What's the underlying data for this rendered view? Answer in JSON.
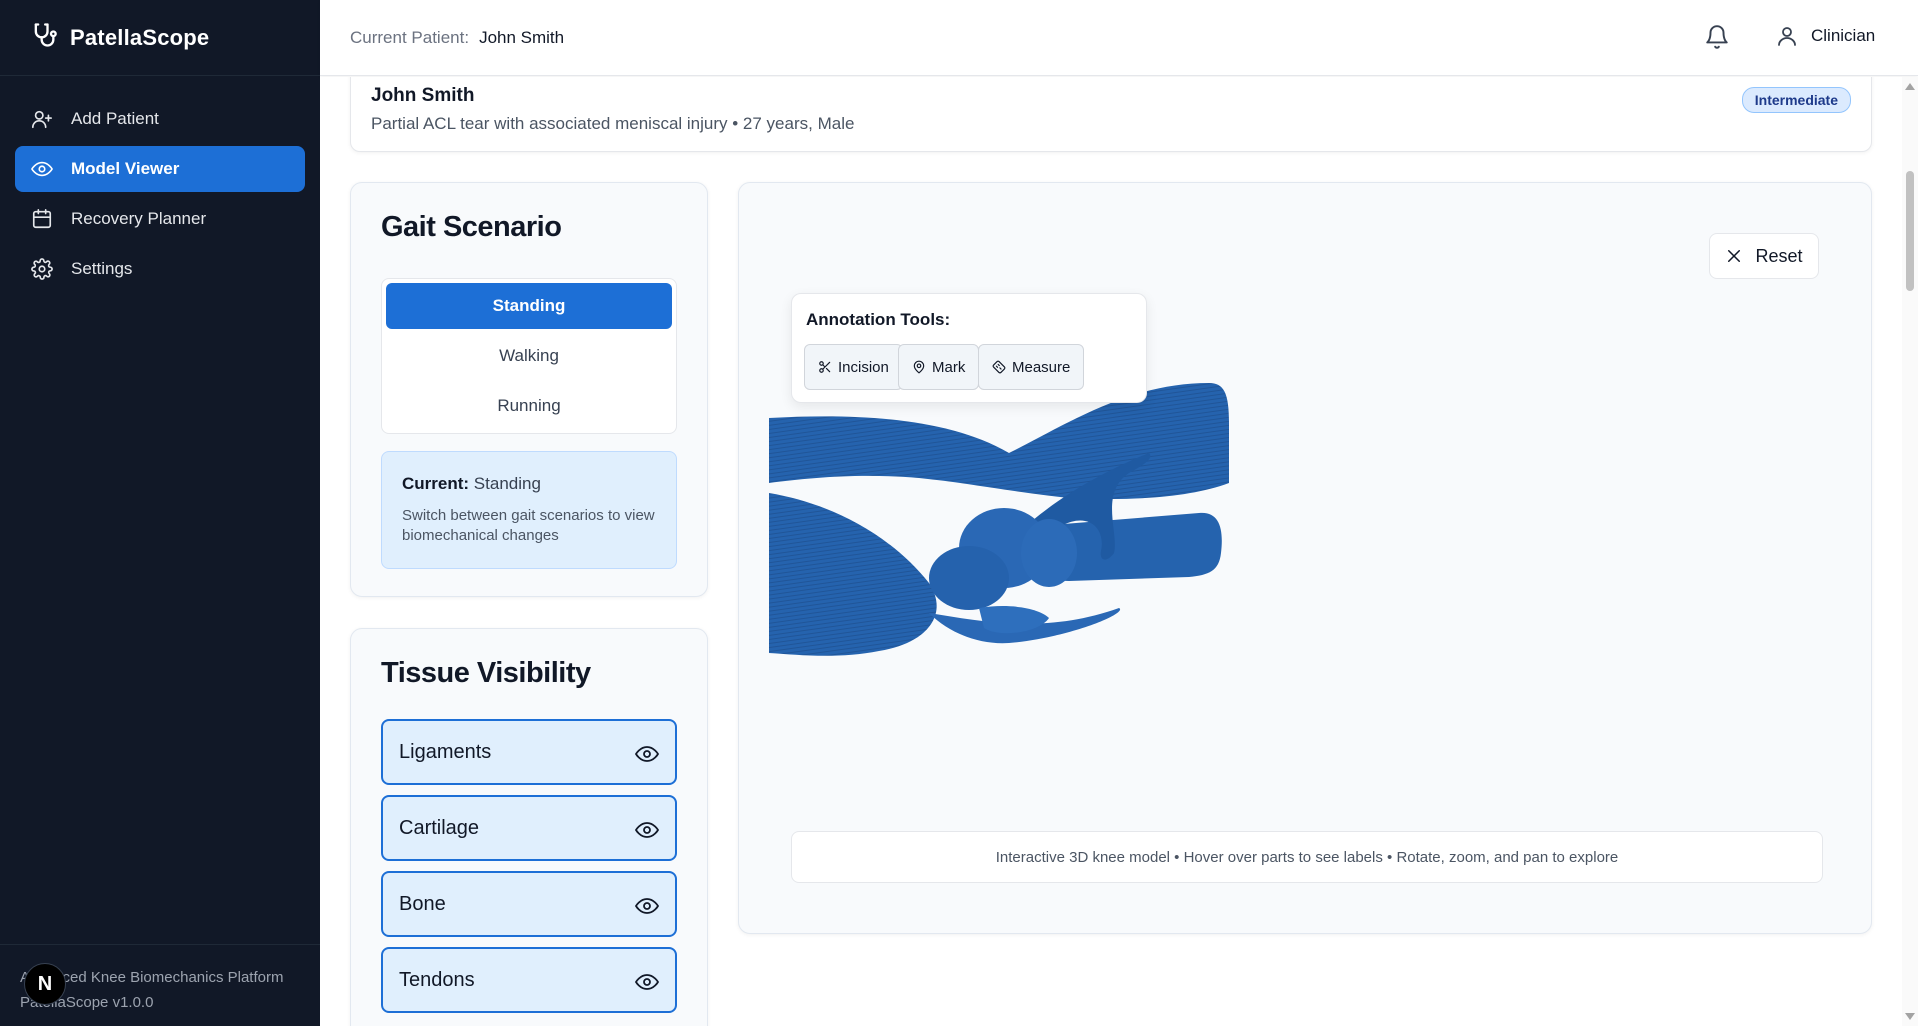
{
  "app": {
    "name": "PatellaScope",
    "logo_icon": "stethoscope-icon"
  },
  "sidebar": {
    "items": [
      {
        "label": "Add Patient",
        "icon": "user-plus-icon",
        "active": false
      },
      {
        "label": "Model Viewer",
        "icon": "eye-icon",
        "active": true
      },
      {
        "label": "Recovery Planner",
        "icon": "calendar-icon",
        "active": false
      },
      {
        "label": "Settings",
        "icon": "gear-icon",
        "active": false
      }
    ],
    "footer_line1": "Advanced Knee Biomechanics Platform",
    "footer_line2": "PatellaScope v1.0.0",
    "badge_letter": "N"
  },
  "header": {
    "current_patient_label": "Current Patient:",
    "current_patient_name": "John Smith",
    "user_label": "Clinician"
  },
  "patient": {
    "name": "John Smith",
    "description": "Partial ACL tear with associated meniscal injury • 27 years, Male",
    "severity": "Intermediate"
  },
  "gait": {
    "title": "Gait Scenario",
    "options": [
      "Standing",
      "Walking",
      "Running"
    ],
    "selected": "Standing",
    "current_label": "Current:",
    "current_value": "Standing",
    "help": "Switch between gait scenarios to view biomechanical changes"
  },
  "tissue": {
    "title": "Tissue Visibility",
    "items": [
      "Ligaments",
      "Cartilage",
      "Bone",
      "Tendons"
    ]
  },
  "viewer": {
    "reset_label": "Reset",
    "annotation_title": "Annotation Tools:",
    "tools": [
      "Incision",
      "Mark",
      "Measure"
    ],
    "hint": "Interactive 3D knee model • Hover over parts to see labels • Rotate, zoom, and pan to explore"
  },
  "colors": {
    "sidebar_bg": "#111827",
    "accent": "#1d6fd6",
    "model_blue": "#2563ae"
  }
}
